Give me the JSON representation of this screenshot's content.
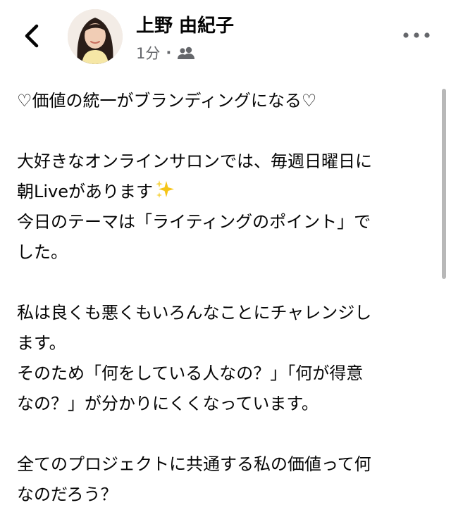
{
  "header": {
    "author_name": "上野 由紀子",
    "time": "1分",
    "separator": "·",
    "icons": {
      "back": "chevron-left-icon",
      "audience": "friends-icon",
      "more": "more-horizontal-icon"
    }
  },
  "post": {
    "lines": [
      "♡価値の統一がブランディングになる♡",
      "",
      "大好きなオンラインサロンでは、毎週日曜日に",
      "朝Liveがあります",
      "今日のテーマは「ライティングのポイント」で",
      "した。",
      "",
      "私は良くも悪くもいろんなことにチャレンジし",
      "ます。",
      "そのため「何をしている人なの？」「何が得意",
      "なの？」が分かりにくくなっています。",
      "",
      "全てのプロジェクトに共通する私の価値って何",
      "なのだろう？"
    ],
    "emoji": "sparkles-icon"
  },
  "colors": {
    "text": "#050505",
    "meta": "#65676b",
    "sparkle": "#f5c518"
  }
}
